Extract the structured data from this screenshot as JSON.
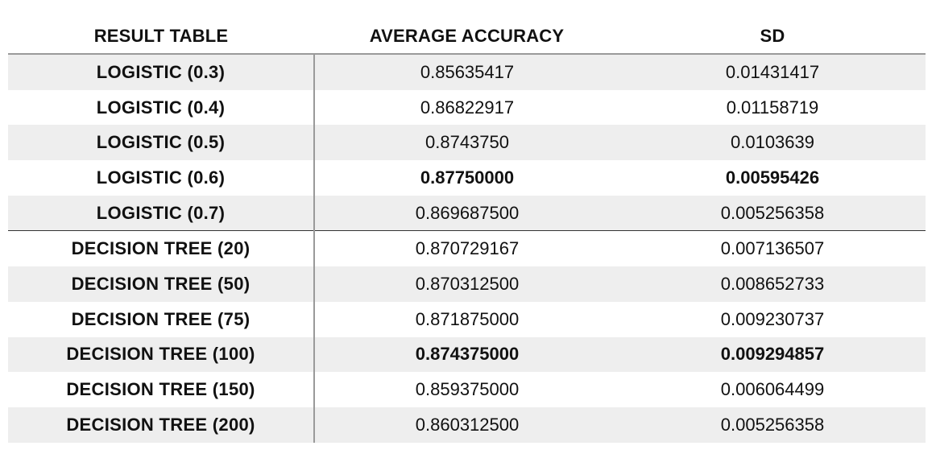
{
  "table": {
    "headers": [
      "RESULT TABLE",
      "AVERAGE ACCURACY",
      "SD"
    ],
    "rows": [
      {
        "name": "LOGISTIC (0.3)",
        "accuracy": "0.85635417",
        "sd": "0.01431417",
        "bold": false
      },
      {
        "name": "LOGISTIC (0.4)",
        "accuracy": "0.86822917",
        "sd": "0.01158719",
        "bold": false
      },
      {
        "name": "LOGISTIC (0.5)",
        "accuracy": "0.8743750",
        "sd": "0.0103639",
        "bold": false
      },
      {
        "name": "LOGISTIC (0.6)",
        "accuracy": "0.87750000",
        "sd": "0.00595426",
        "bold": true
      },
      {
        "name": "LOGISTIC (0.7)",
        "accuracy": "0.869687500",
        "sd": "0.005256358",
        "bold": false
      },
      {
        "name": "DECISION TREE (20)",
        "accuracy": "0.870729167",
        "sd": "0.007136507",
        "bold": false
      },
      {
        "name": "DECISION TREE (50)",
        "accuracy": "0.870312500",
        "sd": "0.008652733",
        "bold": false
      },
      {
        "name": "DECISION TREE (75)",
        "accuracy": "0.871875000",
        "sd": "0.009230737",
        "bold": false
      },
      {
        "name": "DECISION TREE (100)",
        "accuracy": "0.874375000",
        "sd": "0.009294857",
        "bold": true
      },
      {
        "name": "DECISION TREE (150)",
        "accuracy": "0.859375000",
        "sd": "0.006064499",
        "bold": false
      },
      {
        "name": "DECISION TREE (200)",
        "accuracy": "0.860312500",
        "sd": "0.005256358",
        "bold": false
      }
    ]
  }
}
